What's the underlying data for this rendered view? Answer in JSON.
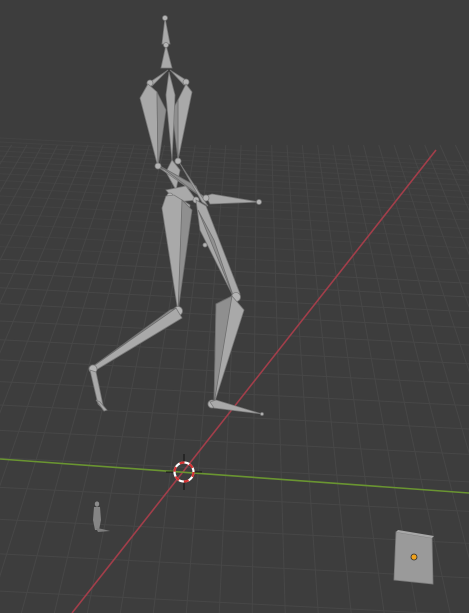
{
  "app": {
    "name": "3D Viewport",
    "view": "perspective"
  },
  "colors": {
    "background": "#3d3d3d",
    "grid_line": "#474747",
    "grid_line_far": "#434343",
    "x_axis": "#a23e4a",
    "y_axis": "#6a9531",
    "bone_fill": "#a9a9a9",
    "cursor_ring_red": "#d63131",
    "cursor_ring_white": "#ffffff",
    "origin_dot": "#f0a21c",
    "cube_fill": "#9a9a9a"
  },
  "scene": {
    "objects": [
      {
        "name": "armature",
        "type": "armature",
        "icon": "bone-icon",
        "selected": false
      },
      {
        "name": "small-character",
        "type": "mesh",
        "icon": "person-icon",
        "selected": false
      },
      {
        "name": "cube",
        "type": "mesh",
        "icon": "cube-icon",
        "selected": false
      }
    ],
    "cursor": {
      "icon": "3d-cursor-icon"
    }
  }
}
